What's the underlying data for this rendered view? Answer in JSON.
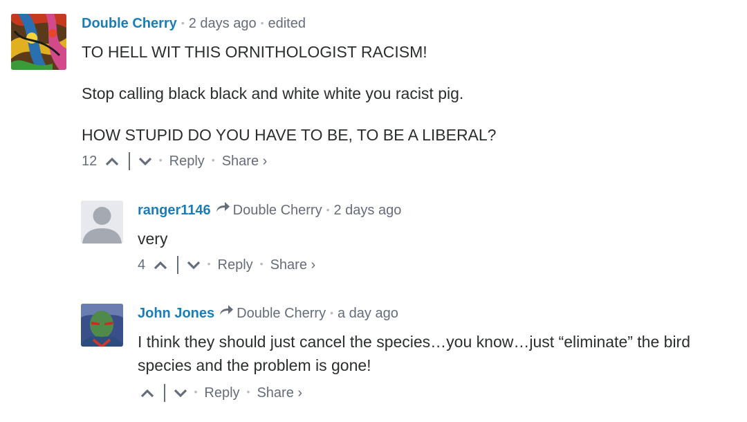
{
  "comments": [
    {
      "author": "Double Cherry",
      "time": "2 days ago",
      "edited": "edited",
      "paragraphs": [
        "TO HELL WIT THIS ORNITHOLOGIST RACISM!",
        "Stop calling black black and white white you racist pig.",
        "HOW STUPID DO YOU HAVE TO BE, TO BE A LIBERAL?"
      ],
      "votes": "12",
      "reply_label": "Reply",
      "share_label": "Share ›"
    },
    {
      "author": "ranger1146",
      "reply_to": "Double Cherry",
      "time": "2 days ago",
      "paragraphs": [
        "very"
      ],
      "votes": "4",
      "reply_label": "Reply",
      "share_label": "Share ›"
    },
    {
      "author": "John Jones",
      "reply_to": "Double Cherry",
      "time": "a day ago",
      "paragraphs": [
        "I think they should just cancel the species…you know…just “eliminate” the bird species and the problem is gone!"
      ],
      "votes": "",
      "reply_label": "Reply",
      "share_label": "Share ›"
    }
  ],
  "colors": {
    "author": "#1a7db5",
    "meta": "#656c7a",
    "text": "#2a2e2e"
  },
  "icons": [
    "upvote-chevron-icon",
    "downvote-chevron-icon",
    "reply-arrow-icon",
    "default-avatar-icon"
  ]
}
